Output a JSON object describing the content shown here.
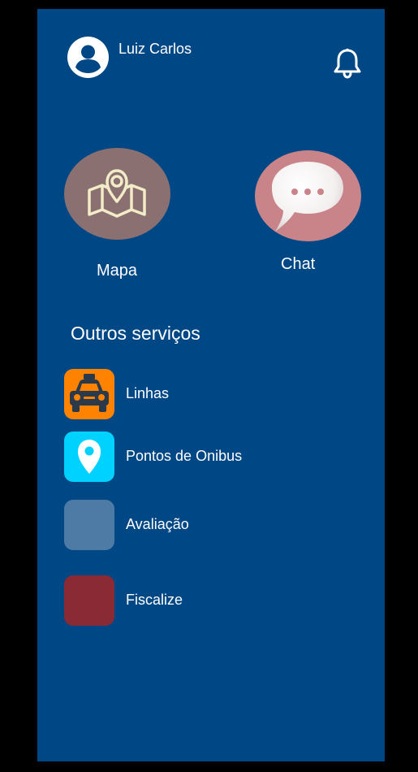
{
  "header": {
    "user_name": "Luiz Carlos",
    "avatar_icon": "user-avatar-icon",
    "notification_icon": "bell-icon"
  },
  "main_actions": [
    {
      "label": "Mapa",
      "icon": "map-pin-icon",
      "color": "#8A7070"
    },
    {
      "label": "Chat",
      "icon": "chat-bubble-icon",
      "color": "#C9848A"
    }
  ],
  "other_services": {
    "title": "Outros serviços",
    "items": [
      {
        "label": "Linhas",
        "icon": "taxi-icon",
        "color": "#FF8200"
      },
      {
        "label": "Pontos de Onibus",
        "icon": "location-pin-icon",
        "color": "#00D2FF"
      },
      {
        "label": "Avaliação",
        "icon": "blank-square-icon",
        "color": "#4D7BA5"
      },
      {
        "label": "Fiscalize",
        "icon": "blank-square-icon",
        "color": "#8A2A34"
      }
    ]
  },
  "colors": {
    "background": "#004785",
    "text": "#FFFFFF"
  }
}
